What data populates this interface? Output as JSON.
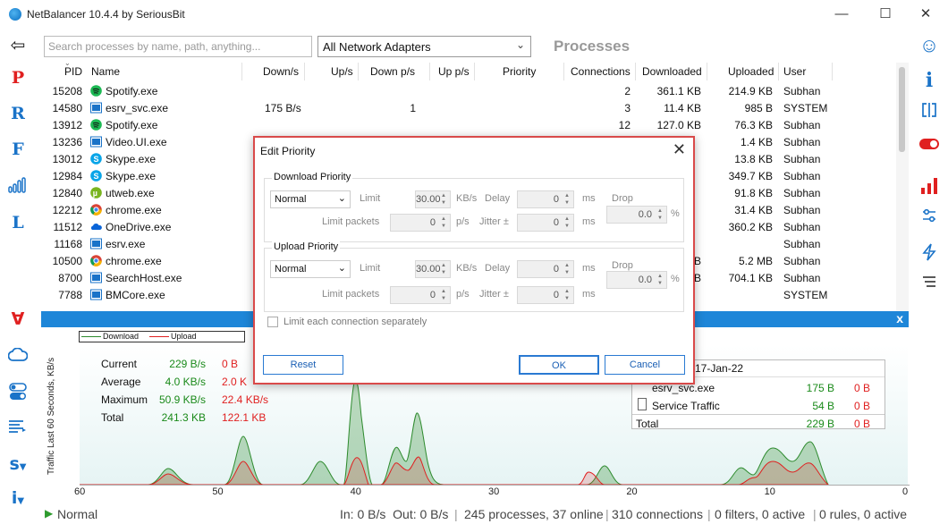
{
  "window": {
    "title": "NetBalancer 10.4.4 by SeriousBit",
    "minimize": "—",
    "maximize": "☐",
    "close": "✕"
  },
  "left_sidebar": {
    "back": "⇦",
    "p": "P",
    "r": "R",
    "f": "F",
    "l": "L",
    "forall": "∀",
    "s": "s",
    "i": "i"
  },
  "right_sidebar": {
    "smiley": "☺",
    "info": "i"
  },
  "toolbar": {
    "search_placeholder": "Search processes by name, path, anything...",
    "adapter": "All Network Adapters",
    "title": "Processes"
  },
  "columns": {
    "pid": "PID",
    "name": "Name",
    "down": "Down/s",
    "up": "Up/s",
    "downp": "Down p/s",
    "upp": "Up p/s",
    "priority": "Priority",
    "connections": "Connections",
    "downloaded": "Downloaded",
    "uploaded": "Uploaded",
    "user": "User"
  },
  "rows": [
    {
      "pid": "15208",
      "name": "Spotify.exe",
      "down": "",
      "downp": "",
      "conn": "2",
      "dl": "361.1 KB",
      "ul": "214.9 KB",
      "user": "Subhan",
      "icon": "spotify"
    },
    {
      "pid": "14580",
      "name": "esrv_svc.exe",
      "down": "175 B/s",
      "downp": "1",
      "conn": "3",
      "dl": "11.4 KB",
      "ul": "985 B",
      "user": "SYSTEM",
      "icon": "app"
    },
    {
      "pid": "13912",
      "name": "Spotify.exe",
      "down": "",
      "downp": "",
      "conn": "12",
      "dl": "127.0 KB",
      "ul": "76.3 KB",
      "user": "Subhan",
      "icon": "spotify"
    },
    {
      "pid": "13236",
      "name": "Video.UI.exe",
      "down": "",
      "downp": "",
      "conn": "",
      "dl": "",
      "ul": "1.4 KB",
      "user": "Subhan",
      "icon": "app"
    },
    {
      "pid": "13012",
      "name": "Skype.exe",
      "down": "",
      "downp": "",
      "conn": "",
      "dl": "",
      "ul": "13.8 KB",
      "user": "Subhan",
      "icon": "skype"
    },
    {
      "pid": "12984",
      "name": "Skype.exe",
      "down": "",
      "downp": "",
      "conn": "",
      "dl": "",
      "ul": "349.7 KB",
      "user": "Subhan",
      "icon": "skype"
    },
    {
      "pid": "12840",
      "name": "utweb.exe",
      "down": "",
      "downp": "",
      "conn": "",
      "dl": "",
      "ul": "91.8 KB",
      "user": "Subhan",
      "icon": "utorrent"
    },
    {
      "pid": "12212",
      "name": "chrome.exe",
      "down": "",
      "downp": "",
      "conn": "",
      "dl": "",
      "ul": "31.4 KB",
      "user": "Subhan",
      "icon": "chrome"
    },
    {
      "pid": "11512",
      "name": "OneDrive.exe",
      "down": "",
      "downp": "",
      "conn": "",
      "dl": "",
      "ul": "360.2 KB",
      "user": "Subhan",
      "icon": "onedrive"
    },
    {
      "pid": "11168",
      "name": "esrv.exe",
      "down": "",
      "downp": "",
      "conn": "",
      "dl": "",
      "ul": "",
      "user": "Subhan",
      "icon": "app"
    },
    {
      "pid": "10500",
      "name": "chrome.exe",
      "down": "",
      "downp": "",
      "conn": "",
      "dl": "B",
      "ul": "5.2 MB",
      "user": "Subhan",
      "icon": "chrome"
    },
    {
      "pid": "8700",
      "name": "SearchHost.exe",
      "down": "",
      "downp": "",
      "conn": "",
      "dl": "B",
      "ul": "704.1 KB",
      "user": "Subhan",
      "icon": "app"
    },
    {
      "pid": "7788",
      "name": "BMCore.exe",
      "down": "",
      "downp": "",
      "conn": "",
      "dl": "",
      "ul": "",
      "user": "SYSTEM",
      "icon": "app"
    }
  ],
  "graph": {
    "legend_download": "Download",
    "legend_upload": "Upload",
    "ylabel": "Traffic Last 60 Seconds, KB/s",
    "stats": [
      {
        "label": "Current",
        "down": "229 B/s",
        "up": "0 B"
      },
      {
        "label": "Average",
        "down": "4.0 KB/s",
        "up": "2.0 K"
      },
      {
        "label": "Maximum",
        "down": "50.9 KB/s",
        "up": "22.4 KB/s"
      },
      {
        "label": "Total",
        "down": "241.3 KB",
        "up": "122.1 KB"
      }
    ],
    "xticks": [
      "60",
      "50",
      "40",
      "30",
      "20",
      "10",
      "0"
    ],
    "date": "17-Jan-22",
    "table": [
      {
        "name": "esrv_svc.exe",
        "down": "175 B",
        "up": "0 B"
      },
      {
        "name": "Service Traffic",
        "down": "54 B",
        "up": "0 B"
      },
      {
        "name": "Total",
        "down": "229 B",
        "up": "0 B"
      }
    ],
    "download_color": "#2e8b2e",
    "upload_color": "#e02020"
  },
  "dialog": {
    "title": "Edit Priority",
    "download_group": "Download Priority",
    "upload_group": "Upload Priority",
    "priority": "Normal",
    "limit": "Limit",
    "limit_val": "30.00",
    "kbs": "KB/s",
    "delay": "Delay",
    "delay_val": "0",
    "ms": "ms",
    "drop": "Drop",
    "drop_val": "0.0",
    "pct": "%",
    "limit_packets": "Limit packets",
    "packets_val": "0",
    "ps": "p/s",
    "jitter": "Jitter ±",
    "jitter_val": "0",
    "limit_each": "Limit each connection separately",
    "reset": "Reset",
    "ok": "OK",
    "cancel": "Cancel"
  },
  "status": {
    "mode": "Normal",
    "in_out": "In: 0 B/s  Out: 0 B/s",
    "processes": "245 processes, 37 online",
    "connections": "310 connections",
    "filters": "0 filters, 0 active",
    "rules": "0 rules, 0 active"
  }
}
